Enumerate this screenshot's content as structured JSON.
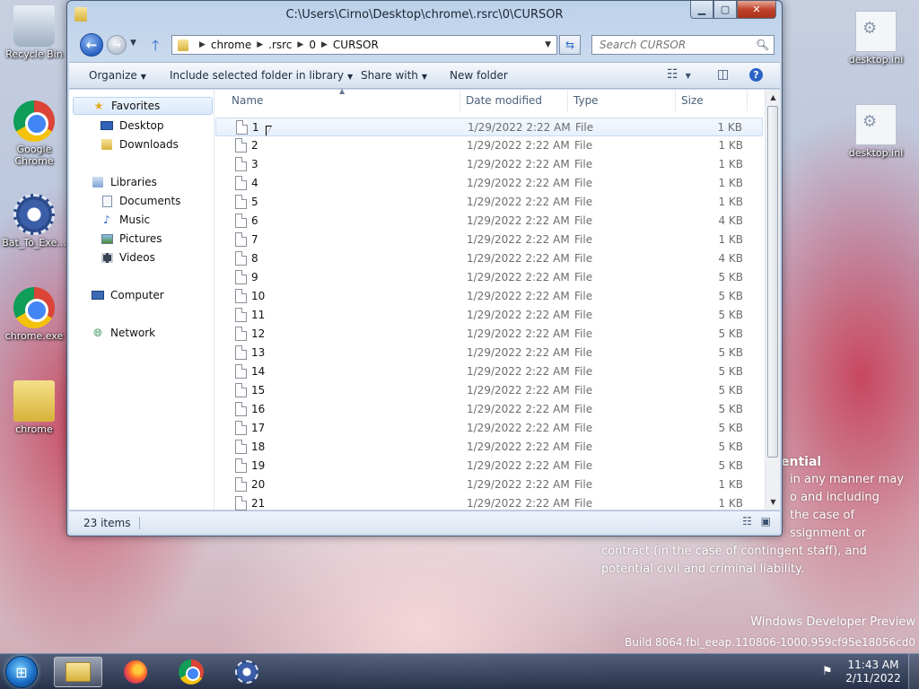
{
  "desktop": {
    "icons_left": [
      {
        "label": "Recycle Bin",
        "icon": "recycle-bin-icon"
      },
      {
        "label": "Google Chrome",
        "icon": "chrome-icon"
      },
      {
        "label": "Bat_To_Exe...",
        "icon": "gear-icon"
      },
      {
        "label": "chrome.exe",
        "icon": "chrome-icon"
      },
      {
        "label": "chrome",
        "icon": "folder-icon"
      }
    ],
    "icons_right": [
      {
        "label": "desktop.ini",
        "icon": "settings-file-icon"
      },
      {
        "label": "desktop.ini",
        "icon": "settings-file-icon"
      }
    ],
    "confidential_heading": "ential",
    "confidential_lines": [
      "in any manner may",
      "o and including",
      "the case of",
      "ssignment or",
      "contract (in the case of contingent staff), and",
      "potential civil and criminal liability."
    ],
    "watermark_line1": "Windows Developer Preview",
    "watermark_line2": "Build 8064.fbl_eeap.110806-1000.959cf95e18056cd0"
  },
  "window": {
    "title": "C:\\Users\\Cirno\\Desktop\\chrome\\.rsrc\\0\\CURSOR",
    "caption": {
      "minimize": "▁",
      "maximize": "▢",
      "close": "✕"
    },
    "address": {
      "crumbs": [
        "chrome",
        ".rsrc",
        "0",
        "CURSOR"
      ]
    },
    "search_placeholder": "Search CURSOR",
    "toolbar": {
      "organize": "Organize",
      "include": "Include selected folder in library",
      "share": "Share with",
      "new_folder": "New folder"
    },
    "nav": {
      "favorites": "Favorites",
      "desktop": "Desktop",
      "downloads": "Downloads",
      "libraries": "Libraries",
      "documents": "Documents",
      "music": "Music",
      "pictures": "Pictures",
      "videos": "Videos",
      "computer": "Computer",
      "network": "Network"
    },
    "columns": {
      "name": "Name",
      "date": "Date modified",
      "type": "Type",
      "size": "Size"
    },
    "files": [
      {
        "name": "1",
        "date": "1/29/2022 2:22 AM",
        "type": "File",
        "size": "1 KB"
      },
      {
        "name": "2",
        "date": "1/29/2022 2:22 AM",
        "type": "File",
        "size": "1 KB"
      },
      {
        "name": "3",
        "date": "1/29/2022 2:22 AM",
        "type": "File",
        "size": "1 KB"
      },
      {
        "name": "4",
        "date": "1/29/2022 2:22 AM",
        "type": "File",
        "size": "1 KB"
      },
      {
        "name": "5",
        "date": "1/29/2022 2:22 AM",
        "type": "File",
        "size": "1 KB"
      },
      {
        "name": "6",
        "date": "1/29/2022 2:22 AM",
        "type": "File",
        "size": "4 KB"
      },
      {
        "name": "7",
        "date": "1/29/2022 2:22 AM",
        "type": "File",
        "size": "1 KB"
      },
      {
        "name": "8",
        "date": "1/29/2022 2:22 AM",
        "type": "File",
        "size": "4 KB"
      },
      {
        "name": "9",
        "date": "1/29/2022 2:22 AM",
        "type": "File",
        "size": "5 KB"
      },
      {
        "name": "10",
        "date": "1/29/2022 2:22 AM",
        "type": "File",
        "size": "5 KB"
      },
      {
        "name": "11",
        "date": "1/29/2022 2:22 AM",
        "type": "File",
        "size": "5 KB"
      },
      {
        "name": "12",
        "date": "1/29/2022 2:22 AM",
        "type": "File",
        "size": "5 KB"
      },
      {
        "name": "13",
        "date": "1/29/2022 2:22 AM",
        "type": "File",
        "size": "5 KB"
      },
      {
        "name": "14",
        "date": "1/29/2022 2:22 AM",
        "type": "File",
        "size": "5 KB"
      },
      {
        "name": "15",
        "date": "1/29/2022 2:22 AM",
        "type": "File",
        "size": "5 KB"
      },
      {
        "name": "16",
        "date": "1/29/2022 2:22 AM",
        "type": "File",
        "size": "5 KB"
      },
      {
        "name": "17",
        "date": "1/29/2022 2:22 AM",
        "type": "File",
        "size": "5 KB"
      },
      {
        "name": "18",
        "date": "1/29/2022 2:22 AM",
        "type": "File",
        "size": "5 KB"
      },
      {
        "name": "19",
        "date": "1/29/2022 2:22 AM",
        "type": "File",
        "size": "5 KB"
      },
      {
        "name": "20",
        "date": "1/29/2022 2:22 AM",
        "type": "File",
        "size": "1 KB"
      },
      {
        "name": "21",
        "date": "1/29/2022 2:22 AM",
        "type": "File",
        "size": "1 KB"
      }
    ],
    "status": {
      "item_count": "23 items"
    }
  },
  "taskbar": {
    "clock_time": "11:43 AM",
    "clock_date": "2/11/2022"
  }
}
